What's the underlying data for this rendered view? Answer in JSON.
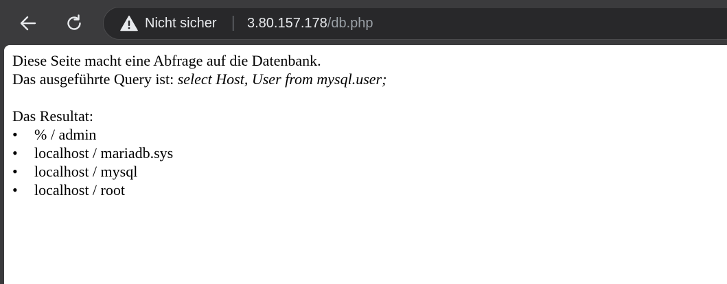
{
  "browser": {
    "security_label": "Nicht sicher",
    "url_host": "3.80.157.178",
    "url_path": "/db.php",
    "icons": {
      "back": "arrow-left-icon",
      "reload": "reload-icon",
      "warning": "warning-triangle-icon"
    }
  },
  "page": {
    "intro": "Diese Seite macht eine Abfrage auf die Datenbank.",
    "query_prefix": "Das ausgeführte Query ist: ",
    "query": "select Host, User from mysql.user;",
    "result_heading": "Das Resultat:",
    "bullet": "•",
    "results": [
      "% / admin",
      "localhost / mariadb.sys",
      "localhost / mysql",
      "localhost / root"
    ]
  }
}
